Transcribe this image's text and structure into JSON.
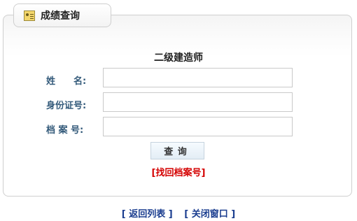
{
  "tab": {
    "title": "成绩查询",
    "icon": "certificate-icon"
  },
  "form": {
    "title": "二级建造师",
    "name_label": "姓　　名:",
    "id_label": "身份证号:",
    "archive_label": "档 案 号:",
    "name_value": "",
    "id_value": "",
    "archive_value": "",
    "query_label": "查询",
    "recover_label": "[找回档案号]"
  },
  "footer": {
    "back_label": "[ 返回列表 ]",
    "close_label": "[ 关闭窗口 ]"
  },
  "colors": {
    "label": "#335a7a",
    "recover": "#d40000",
    "link": "#1a3d8f"
  }
}
